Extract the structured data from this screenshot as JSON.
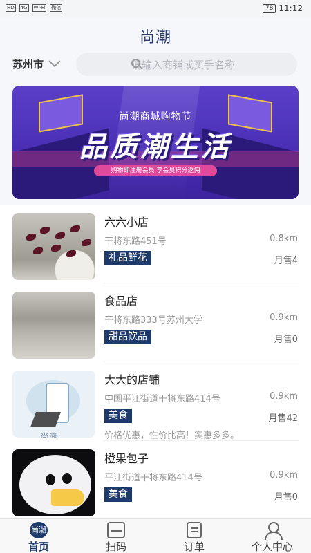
{
  "status_bar": {
    "left_badges": [
      "HD",
      "4G",
      "Wi-Fi",
      "微信"
    ],
    "battery": "78",
    "time": "11:12"
  },
  "header": {
    "logo_text": "尚潮"
  },
  "search": {
    "city": "苏州市",
    "placeholder": "请输入商铺或买手名称"
  },
  "banner": {
    "subtitle": "尚潮商城购物节",
    "title": "品质潮生活",
    "tagline": "购物即注册会员  享会员积分返佣"
  },
  "shops": [
    {
      "name": "六六小店",
      "address": "干将东路451号",
      "distance": "0.8km",
      "tag": "礼品鲜花",
      "sales": "月售4",
      "description": ""
    },
    {
      "name": "食品店",
      "address": "干将东路333号苏州大学",
      "distance": "0.9km",
      "tag": "甜品饮品",
      "sales": "月售0",
      "description": ""
    },
    {
      "name": "大大的店铺",
      "address": "中国平江街道干将东路414号",
      "distance": "0.9km",
      "tag": "美食",
      "sales": "月售42",
      "description": "价格优惠，性价比高！实惠多多。"
    },
    {
      "name": "橙果包子",
      "address": "平江街道干将东路414号",
      "distance": "0.9km",
      "tag": "美食",
      "sales": "月售0",
      "description": ""
    }
  ],
  "thumb3_mark": "尚潮",
  "nav": {
    "home_icon_text": "尚潮",
    "items": [
      {
        "label": "首页",
        "icon": "home-icon",
        "active": true
      },
      {
        "label": "扫码",
        "icon": "scan-icon",
        "active": false
      },
      {
        "label": "订单",
        "icon": "order-icon",
        "active": false
      },
      {
        "label": "个人中心",
        "icon": "user-icon",
        "active": false
      }
    ]
  },
  "colors": {
    "brand": "#1d3a6b",
    "background": "#f6f7fa",
    "banner": "#4a2fb6"
  }
}
